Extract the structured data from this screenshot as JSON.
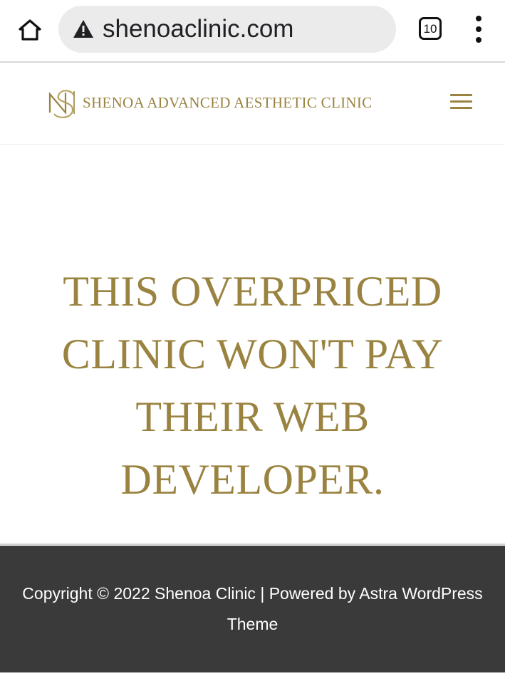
{
  "browser": {
    "url": "shenoaclinic.com",
    "tab_count": "10",
    "home_icon": "home-icon",
    "security_icon": "warning-triangle-icon",
    "menu_icon": "more-vert-icon"
  },
  "header": {
    "site_name": "SHENOA ADVANCED AESTHETIC CLINIC",
    "logo_icon": "sn-monogram-logo",
    "menu_icon": "hamburger-menu-icon"
  },
  "main": {
    "headline": "THIS OVERPRICED CLINIC WON'T PAY THEIR WEB DEVELOPER."
  },
  "footer": {
    "copyright": "Copyright © 2022 Shenoa Clinic | Powered by",
    "theme_link": "Astra WordPress Theme"
  },
  "colors": {
    "accent_gold": "#9a8340",
    "footer_bg": "#3a3a3a",
    "omnibox_bg": "#ebebeb"
  }
}
